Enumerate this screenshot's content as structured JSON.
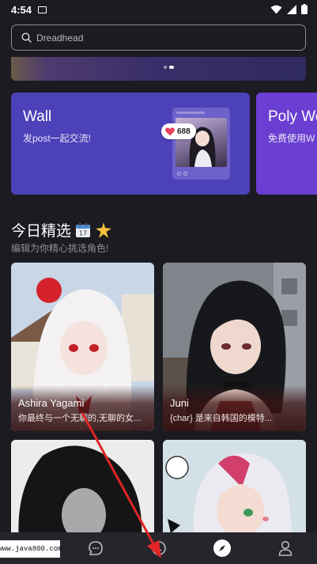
{
  "status_bar": {
    "time": "4:54"
  },
  "search": {
    "placeholder": "Dreadhead"
  },
  "features": [
    {
      "title": "Wall",
      "subtitle": "发post一起交流!",
      "likes": "688"
    },
    {
      "title": "Poly We",
      "subtitle": "免费使用W"
    }
  ],
  "section": {
    "title": "今日精选",
    "subtitle": "编辑为你精心挑选角色!"
  },
  "characters": [
    {
      "name": "Ashira Yagami",
      "desc": "你最终与一个无聊的,无聊的女..."
    },
    {
      "name": "Juni",
      "desc": "{char} 是来自韩国的模特..."
    },
    {
      "name": "",
      "desc": ""
    },
    {
      "name": "",
      "desc": ""
    }
  ],
  "nav": {
    "items": [
      "chat-icon",
      "home-icon",
      "discover-icon",
      "profile-icon"
    ],
    "active": "discover-icon"
  },
  "watermark": "www.java800.com",
  "colors": {
    "background": "#1c1b22",
    "wall_card": "#4c41b8",
    "poly_card": "#6b3fd2",
    "arrow": "#e02525",
    "like": "#e8415b"
  }
}
